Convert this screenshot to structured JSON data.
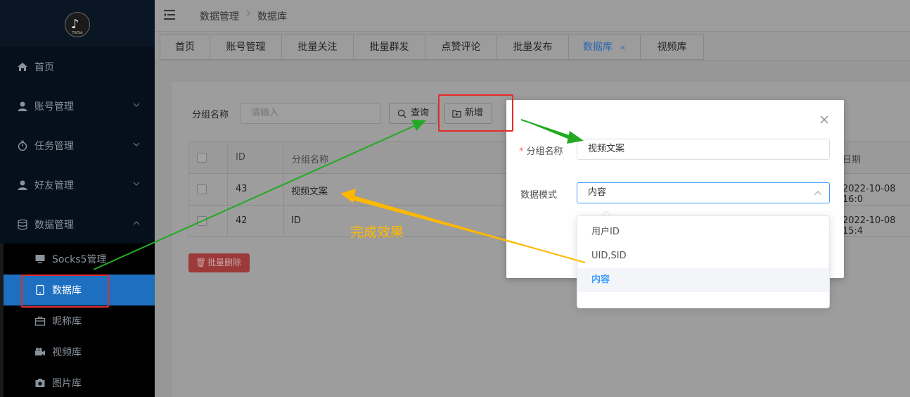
{
  "sidebar": {
    "logo_text": "TikTok",
    "items": [
      {
        "label": "首页"
      },
      {
        "label": "账号管理"
      },
      {
        "label": "任务管理"
      },
      {
        "label": "好友管理"
      },
      {
        "label": "数据管理"
      }
    ],
    "sub_items": [
      {
        "label": "Socks5管理"
      },
      {
        "label": "数据库"
      },
      {
        "label": "昵称库"
      },
      {
        "label": "视频库"
      },
      {
        "label": "图片库"
      }
    ]
  },
  "breadcrumb": {
    "parent": "数据管理",
    "current": "数据库"
  },
  "tabs": [
    {
      "label": "首页"
    },
    {
      "label": "账号管理"
    },
    {
      "label": "批量关注"
    },
    {
      "label": "批量群发"
    },
    {
      "label": "点赞评论"
    },
    {
      "label": "批量发布"
    },
    {
      "label": "数据库",
      "close": "×"
    },
    {
      "label": "视频库"
    }
  ],
  "search": {
    "label": "分组名称",
    "placeholder": "请输入",
    "query_label": "查询",
    "add_label": "新增"
  },
  "table": {
    "headers": [
      "ID",
      "分组名称",
      "日期"
    ],
    "rows": [
      {
        "id": "43",
        "name": "视频文案",
        "date": "2022-10-08 16:0"
      },
      {
        "id": "42",
        "name": "ID",
        "date": "2022-10-08 15:4"
      }
    ]
  },
  "batch_delete_label": "批量删除",
  "dialog": {
    "name_label": "分组名称",
    "required_mark": "*",
    "name_value": "视频文案",
    "mode_label": "数据模式",
    "mode_value": "内容",
    "options": [
      "用户ID",
      "UID,SID",
      "内容"
    ]
  },
  "annotation": {
    "text": "完成效果"
  },
  "colors": {
    "accent": "#409eff",
    "active_menu": "#1e6fc0",
    "annotation_red": "#e62b2b",
    "arrow_green": "#22aa22",
    "arrow_yellow": "#ffb800"
  }
}
